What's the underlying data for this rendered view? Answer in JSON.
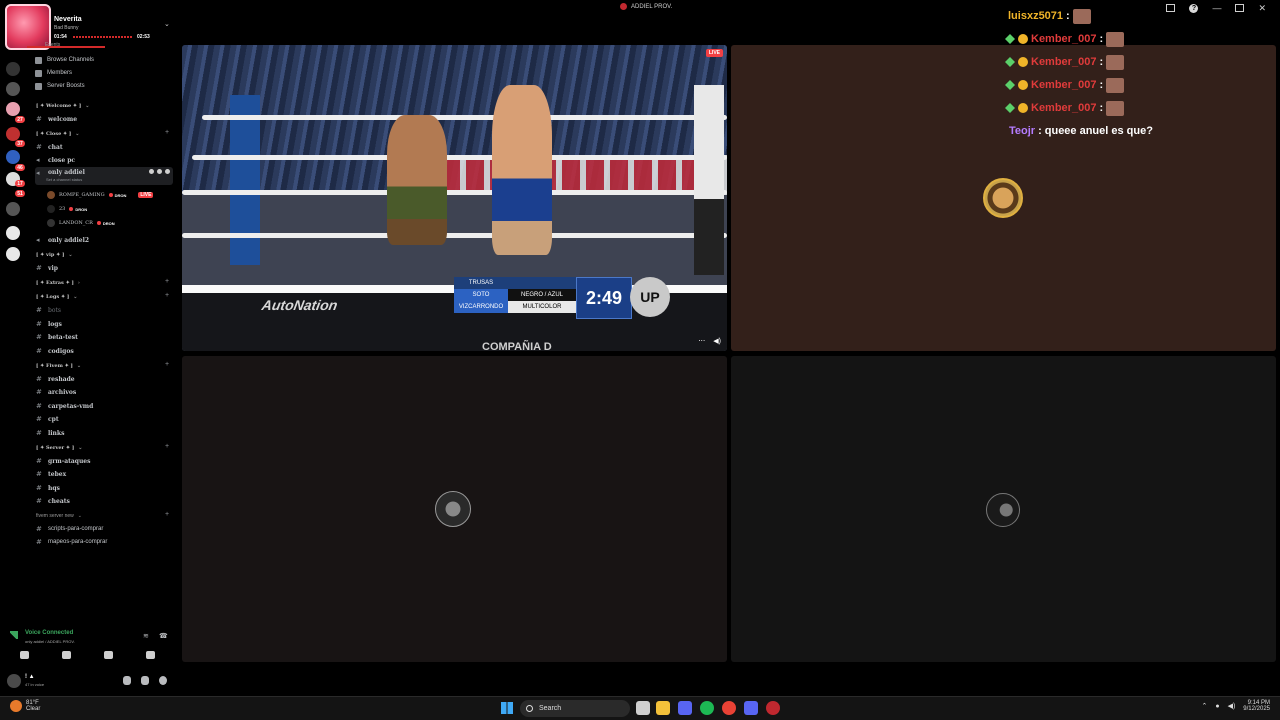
{
  "window": {
    "app_title": "ADDIEL PROV."
  },
  "music": {
    "title": "Neverita",
    "artist": "Bad Bunny",
    "elapsed": "01:54",
    "duration": "02:53",
    "progress_fraction": 0.66,
    "events_label": "Events"
  },
  "nav": {
    "browse": "Browse Channels",
    "members": "Members",
    "boosts": "Server Boosts"
  },
  "categories": {
    "welcome": "[ ✦ Welcome ✦ ]",
    "close": "[ ✦ Close ✦ ]",
    "vip": "[ ✦ vip ✦ ]",
    "extras": "[ ✦ Extras ✦ ]",
    "logs": "[ ✦ Logs ✦ ]",
    "fivem": "[ ✦ Fivem ✦ ]",
    "server": "[ ✦ Server ✦ ]",
    "fivem_new": "fivem server new"
  },
  "channels": {
    "welcome": "welcome",
    "chat": "chat",
    "close_pc": "close pc",
    "only_addiel": "only addiel",
    "channel_status": "Set a channel status",
    "only_addiel2": "only addiel2",
    "vip": "vip",
    "bots": "bots",
    "logs": "logs",
    "beta_test": "beta-test",
    "codigos": "codigos",
    "reshade": "reshade",
    "archivos": "archivos",
    "carpetas_vmd": "carpetas-vmd",
    "cpt": "cpt",
    "links": "links",
    "grm_ataques": "grm-ataques",
    "tebex": "tebex",
    "hqs": "hqs",
    "cheats": "cheats",
    "scripts": "scripts-para-comprar",
    "mapeos": "mapeos-para-comprar"
  },
  "voice_users": [
    {
      "name": "ROMPE_GAMING",
      "tag": "DRON",
      "live": "LIVE"
    },
    {
      "name": "23",
      "tag": "DRON"
    },
    {
      "name": "LANDON_CR",
      "tag": "DRON"
    }
  ],
  "voice_panel": {
    "status": "Voice Connected",
    "channel": "only addiel / ADDIEL PROV."
  },
  "user_panel": {
    "name": "! ▲",
    "status": "47 in voice"
  },
  "rail_badges": [
    "27",
    "37",
    "46",
    "17",
    "51"
  ],
  "stream": {
    "live": "LIVE",
    "apron_logo": "AutoNation",
    "apron_text": "COMPAÑIA D",
    "score": {
      "col1": [
        "TRUSAS",
        "SOTO",
        "VIZCARRONDO"
      ],
      "col2": [
        "",
        "NEGRO / AZUL",
        "MULTICOLOR"
      ],
      "time": "2:49",
      "logo": "UP"
    }
  },
  "chat": [
    {
      "user": "luisxz5071",
      "color": "#f0b429",
      "text": ""
    },
    {
      "user": "Kember_007",
      "color": "#e03b3b",
      "text": ""
    },
    {
      "user": "Kember_007",
      "color": "#e03b3b",
      "text": ""
    },
    {
      "user": "Kember_007",
      "color": "#e03b3b",
      "text": ""
    },
    {
      "user": "Kember_007",
      "color": "#e03b3b",
      "text": ""
    },
    {
      "user": "Teojr",
      "color": "#b57cff",
      "text": "queee anuel es que?"
    }
  ],
  "taskbar": {
    "temp": "81°F",
    "weather": "Clear",
    "search": "Search",
    "time": "9:14 PM",
    "date": "9/12/2025"
  },
  "colors": {
    "accent_red": "#f23f43",
    "voice_green": "#3ba55d",
    "sidebar_bg": "#000000"
  }
}
